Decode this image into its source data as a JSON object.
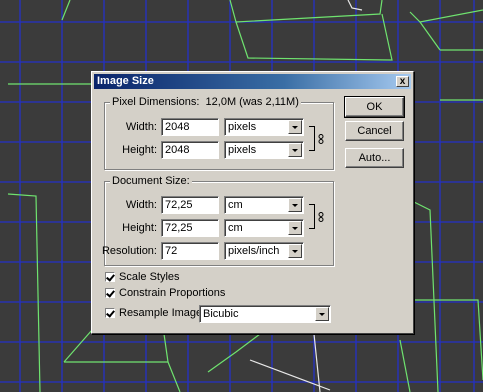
{
  "dialog": {
    "title": "Image Size",
    "close_label": "x"
  },
  "pixel_dimensions": {
    "label": "Pixel Dimensions:",
    "summary": "12,0M (was 2,11M)",
    "width_label": "Width:",
    "width_value": "2048",
    "width_unit": "pixels",
    "height_label": "Height:",
    "height_value": "2048",
    "height_unit": "pixels"
  },
  "document_size": {
    "label": "Document Size:",
    "width_label": "Width:",
    "width_value": "72,25",
    "width_unit": "cm",
    "height_label": "Height:",
    "height_value": "72,25",
    "height_unit": "cm",
    "resolution_label": "Resolution:",
    "resolution_value": "72",
    "resolution_unit": "pixels/inch"
  },
  "options": {
    "scale_styles": {
      "label": "Scale Styles",
      "checked": true
    },
    "constrain_proportions": {
      "label": "Constrain Proportions",
      "checked": true
    },
    "resample_image": {
      "label": "Resample Image:",
      "checked": true,
      "method": "Bicubic"
    }
  },
  "buttons": {
    "ok": "OK",
    "cancel": "Cancel",
    "auto": "Auto..."
  }
}
